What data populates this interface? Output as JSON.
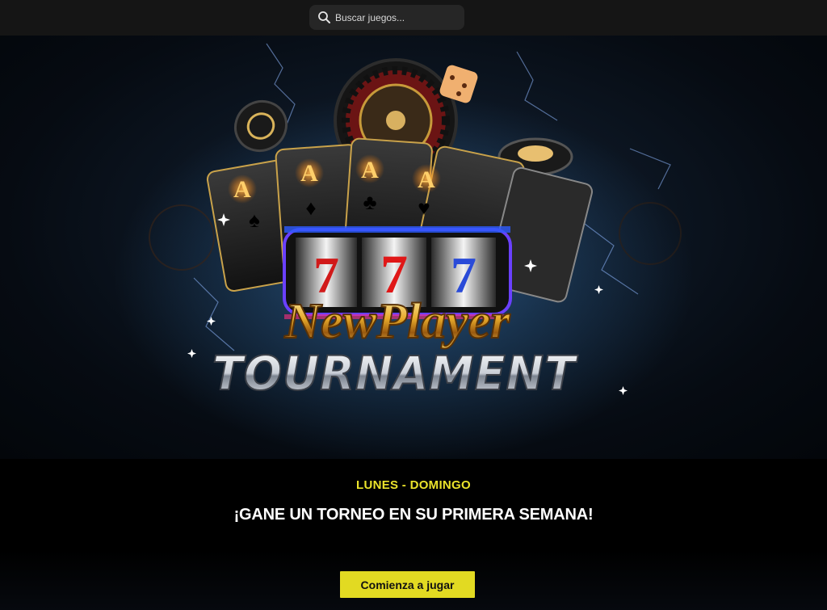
{
  "search": {
    "placeholder": "Buscar juegos...",
    "icon": "search-icon"
  },
  "hero": {
    "logo_line1": "NewPlayer",
    "logo_line2": "TOURNAMENT",
    "slot_symbol": "7",
    "card_rank": "A",
    "card_suits": [
      "♠",
      "♦",
      "♣",
      "♥"
    ]
  },
  "info": {
    "days": "LUNES - DOMINGO",
    "headline": "¡GANE UN TORNEO EN SU PRIMERA SEMANA!",
    "cta": "Comienza a jugar"
  },
  "colors": {
    "accent_yellow": "#e2da22",
    "days_yellow": "#ebe32b",
    "topbar": "#151515",
    "search_bg": "#262626"
  }
}
